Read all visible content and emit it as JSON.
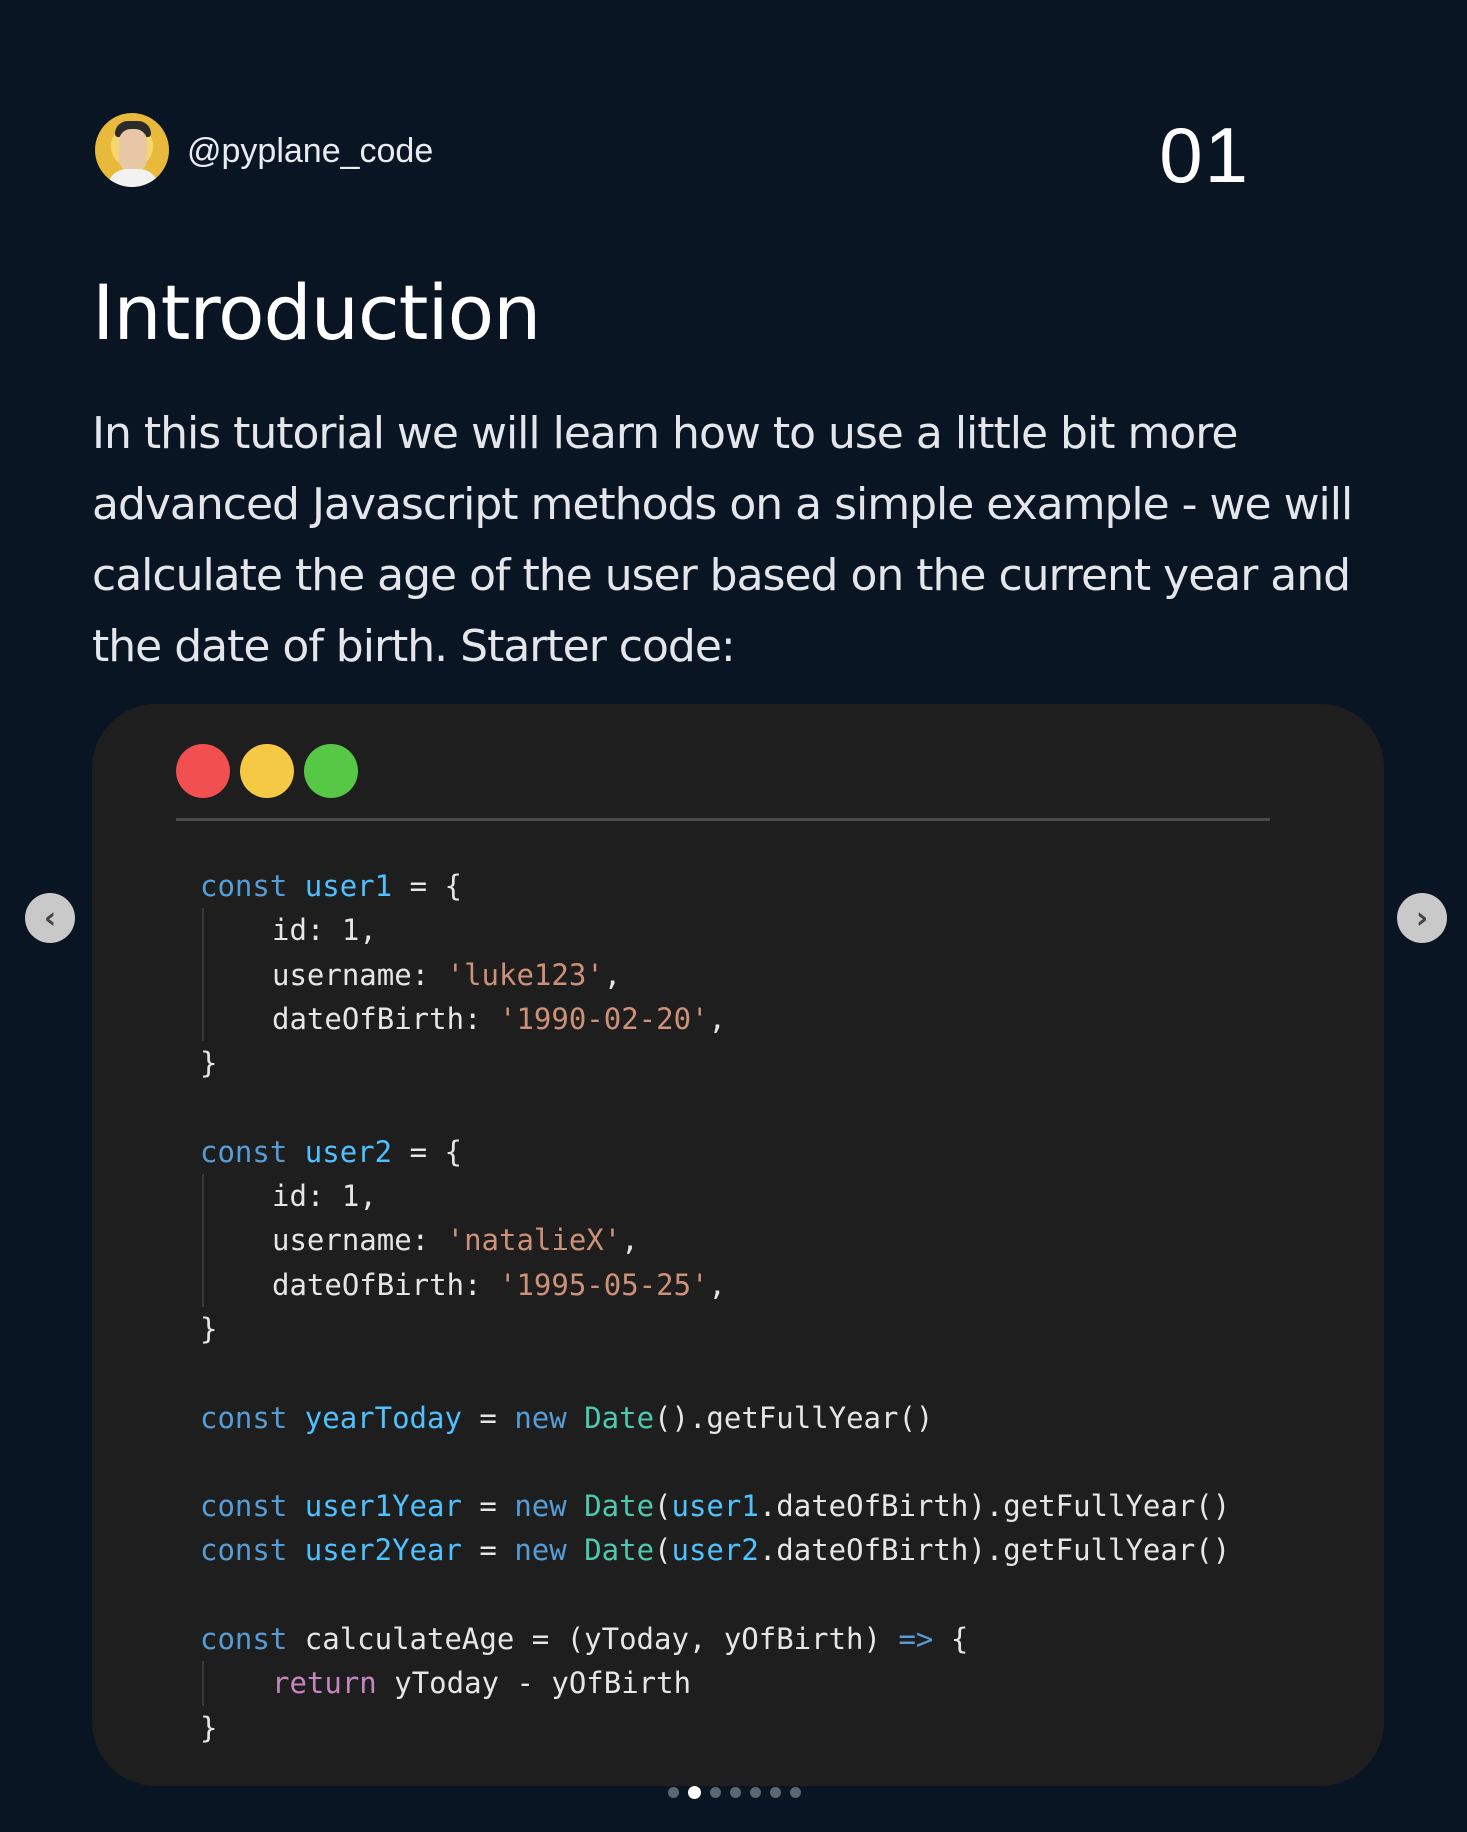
{
  "header": {
    "handle": "@pyplane_code",
    "page_number": "01"
  },
  "title": "Introduction",
  "intro_text": "In this tutorial we will learn how to use a little bit more advanced Javascript methods on a simple example - we will calculate the age of the user based on the current year and the date of birth. Starter code:",
  "window_controls": {
    "colors": {
      "red": "#f24f50",
      "yellow": "#f6c945",
      "green": "#56c845"
    }
  },
  "code": {
    "kw_const": "const",
    "kw_new": "new",
    "kw_return": "return",
    "arrow": "=>",
    "user1_name": "user1",
    "user2_name": "user2",
    "id_label": "id:",
    "id_value": "1,",
    "username_label": "username:",
    "dob_label": "dateOfBirth:",
    "user1_username": "'luke123'",
    "user1_dob": "'1990-02-20'",
    "user2_username": "'natalieX'",
    "user2_dob": "'1995-05-25'",
    "year_today": "yearToday",
    "user1_year": "user1Year",
    "user2_year": "user2Year",
    "calculate_age": "calculateAge",
    "date_class": "Date",
    "get_full_year": ".getFullYear()",
    "params": "(yToday, yOfBirth)",
    "return_expr": "yToday - yOfBirth",
    "equals_brace": "= {",
    "equals": "=",
    "close_brace": "}",
    "comma": ",",
    "dob_access": ".dateOfBirth",
    "paren_empty": "()",
    "paren_open": "(",
    "paren_close": ")",
    "open_brace": "{"
  },
  "navigation": {
    "prev_icon": "chevron-left-icon",
    "next_icon": "chevron-right-icon",
    "prev_glyph": "‹",
    "next_glyph": "›",
    "total_slides": 7,
    "active_slide": 2
  }
}
